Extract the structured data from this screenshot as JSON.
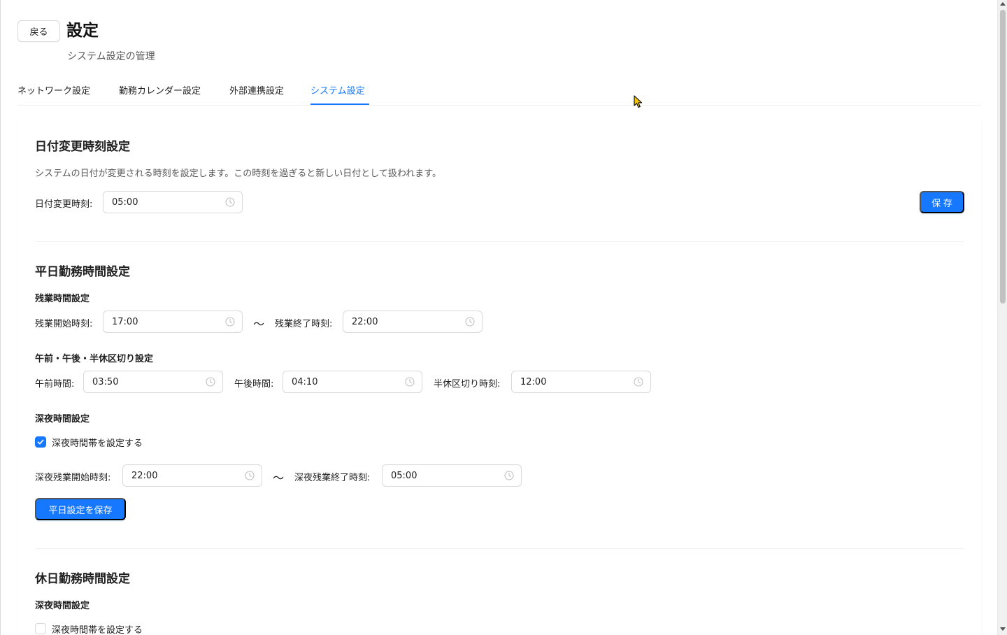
{
  "header": {
    "back_label": "戻る",
    "title": "設定",
    "subtitle": "システム設定の管理"
  },
  "tabs": [
    {
      "label": "ネットワーク設定",
      "active": false
    },
    {
      "label": "勤務カレンダー設定",
      "active": false
    },
    {
      "label": "外部連携設定",
      "active": false
    },
    {
      "label": "システム設定",
      "active": true
    }
  ],
  "date_change": {
    "title": "日付変更時刻設定",
    "description": "システムの日付が変更される時刻を設定します。この時刻を過ぎると新しい日付として扱われます。",
    "label": "日付変更時刻:",
    "value": "05:00",
    "save_label": "保 存"
  },
  "weekday": {
    "title": "平日勤務時間設定",
    "overtime": {
      "title": "残業時間設定",
      "start_label": "残業開始時刻:",
      "start_value": "17:00",
      "separator": "〜",
      "end_label": "残業終了時刻:",
      "end_value": "22:00"
    },
    "half_day": {
      "title": "午前・午後・半休区切り設定",
      "am_label": "午前時間:",
      "am_value": "03:50",
      "pm_label": "午後時間:",
      "pm_value": "04:10",
      "split_label": "半休区切り時刻:",
      "split_value": "12:00"
    },
    "night": {
      "title": "深夜時間設定",
      "checkbox_label": "深夜時間帯を設定する",
      "checked": true,
      "start_label": "深夜残業開始時刻:",
      "start_value": "22:00",
      "separator": "〜",
      "end_label": "深夜残業終了時刻:",
      "end_value": "05:00"
    },
    "save_label": "平日設定を保存"
  },
  "holiday": {
    "title": "休日勤務時間設定",
    "night": {
      "title": "深夜時間設定",
      "checkbox_label": "深夜時間帯を設定する",
      "checked": false
    }
  },
  "colors": {
    "primary": "#1677ff",
    "border": "#d9d9d9",
    "divider": "#f0f0f0",
    "cursor": "#f5c400"
  },
  "icons": {
    "time_input": "clock-icon",
    "checkbox": "check-icon",
    "cursor": "mouse-pointer-icon"
  }
}
